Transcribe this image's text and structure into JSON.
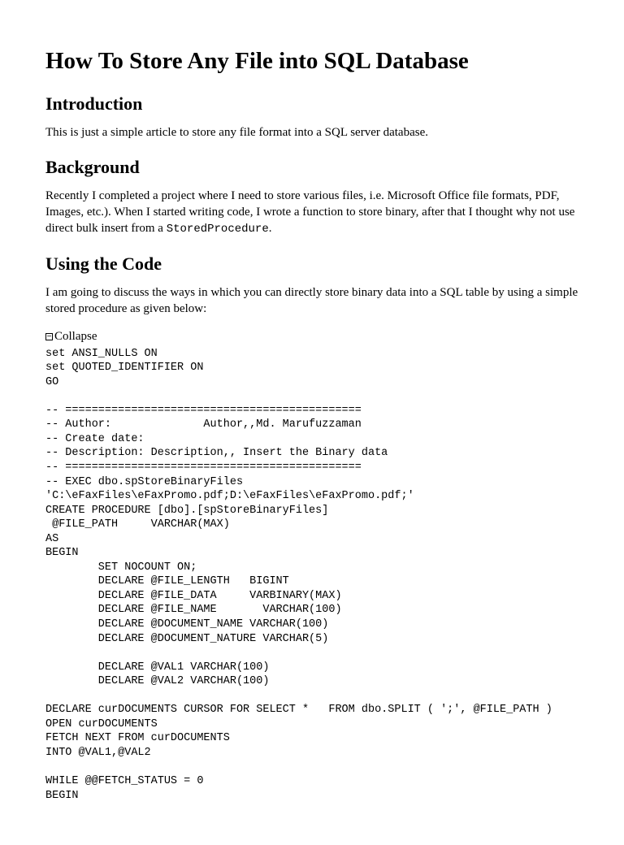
{
  "title": "How To Store Any File into SQL Database",
  "sections": {
    "intro": {
      "heading": "Introduction",
      "text": "This is just a simple article to store any file format into a SQL server database."
    },
    "background": {
      "heading": "Background",
      "text_before": "Recently I completed a project where I need to store various files, i.e. Microsoft Office file formats, PDF, Images, etc.). When I started writing code, I wrote a function to store binary, after that I thought why not use direct bulk insert from a ",
      "code_inline": "StoredProcedure",
      "text_after": "."
    },
    "usingcode": {
      "heading": "Using the Code",
      "text": "I am going to discuss the ways in which you can directly store binary data into a SQL table by using a simple stored procedure as given below:"
    }
  },
  "collapse_label": "Collapse",
  "code": "set ANSI_NULLS ON\nset QUOTED_IDENTIFIER ON\nGO\n\n-- =============================================\n-- Author:              Author,,Md. Marufuzzaman\n-- Create date:\n-- Description: Description,, Insert the Binary data\n-- =============================================\n-- EXEC dbo.spStoreBinaryFiles\n'C:\\eFaxFiles\\eFaxPromo.pdf;D:\\eFaxFiles\\eFaxPromo.pdf;'\nCREATE PROCEDURE [dbo].[spStoreBinaryFiles]\n @FILE_PATH     VARCHAR(MAX)\nAS\nBEGIN\n        SET NOCOUNT ON;\n        DECLARE @FILE_LENGTH   BIGINT\n        DECLARE @FILE_DATA     VARBINARY(MAX)\n        DECLARE @FILE_NAME       VARCHAR(100)\n        DECLARE @DOCUMENT_NAME VARCHAR(100)\n        DECLARE @DOCUMENT_NATURE VARCHAR(5)\n\n        DECLARE @VAL1 VARCHAR(100)\n        DECLARE @VAL2 VARCHAR(100)\n\nDECLARE curDOCUMENTS CURSOR FOR SELECT *   FROM dbo.SPLIT ( ';', @FILE_PATH )\nOPEN curDOCUMENTS\nFETCH NEXT FROM curDOCUMENTS\nINTO @VAL1,@VAL2\n\nWHILE @@FETCH_STATUS = 0\nBEGIN"
}
